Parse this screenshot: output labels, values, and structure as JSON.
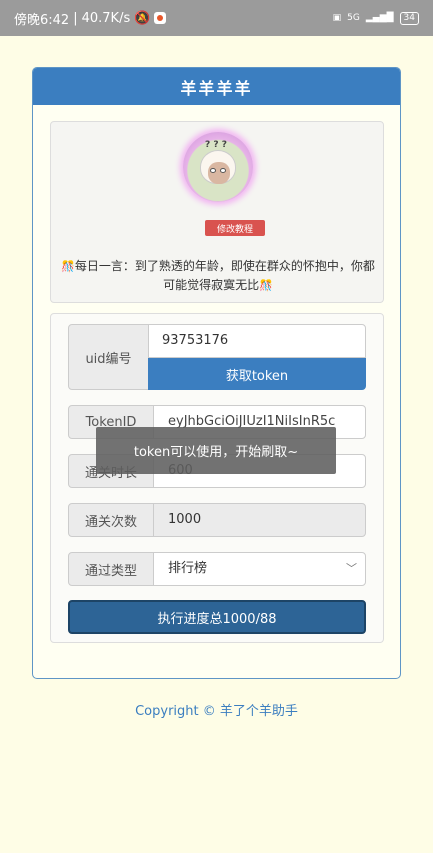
{
  "status_bar": {
    "time": "傍晚6:42",
    "speed": "40.7K/s",
    "network": "5G",
    "battery": "34"
  },
  "card": {
    "title": "羊羊羊羊"
  },
  "profile": {
    "avatar_marks": "? ? ?",
    "guide_label": "修改教程",
    "quote_prefix": "每日一言：",
    "quote_text": "到了熟透的年龄，即使在群众的怀抱中，你都可能觉得寂寞无比"
  },
  "form": {
    "uid_label": "uid编号",
    "uid_value": "93753176",
    "get_token_label": "获取token",
    "token_label": "TokenID",
    "token_value": "eyJhbGciOiJIUzI1NiIsInR5c",
    "time_label": "通关时长",
    "time_value": "600",
    "count_label": "通关次数",
    "count_value": "1000",
    "type_label": "通过类型",
    "type_selected": "排行榜",
    "run_label": "执行进度总1000/88"
  },
  "toast": "token可以使用，开始刷取~",
  "footer": "Copyright © 羊了个羊助手",
  "colors": {
    "accent": "#3b7ec0",
    "run_button": "#2d6496",
    "guide_button": "#d9534f",
    "background": "#fefde6"
  }
}
